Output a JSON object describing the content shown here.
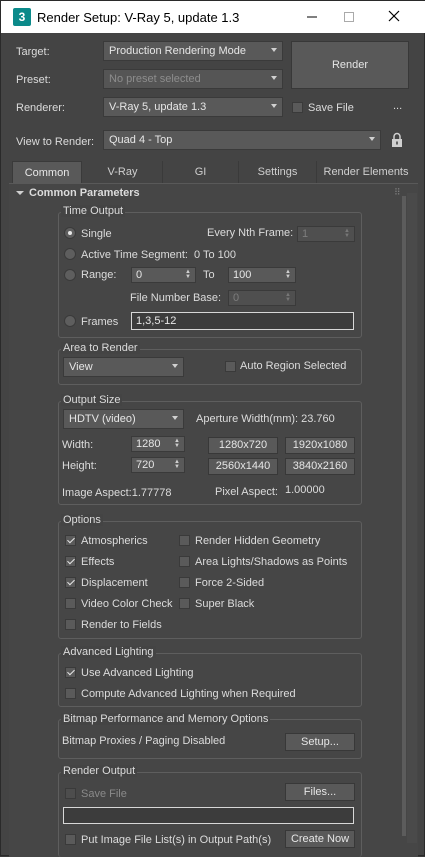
{
  "window": {
    "title": "Render Setup: V-Ray 5, update 1.3",
    "app_icon": "3"
  },
  "top": {
    "target_label": "Target:",
    "target_value": "Production Rendering Mode",
    "preset_label": "Preset:",
    "preset_value": "No preset selected",
    "renderer_label": "Renderer:",
    "renderer_value": "V-Ray 5, update 1.3",
    "render_button": "Render",
    "save_file_label": "Save File",
    "ellipsis": "...",
    "view_label": "View to Render:",
    "view_value": "Quad 4 - Top"
  },
  "tabs": [
    "Common",
    "V-Ray",
    "GI",
    "Settings",
    "Render Elements"
  ],
  "rollout": {
    "title": "Common Parameters"
  },
  "time_output": {
    "title": "Time Output",
    "single": "Single",
    "every_nth": "Every Nth Frame:",
    "every_nth_value": "1",
    "active_segment": "Active Time Segment:",
    "active_segment_value": "0 To 100",
    "range": "Range:",
    "range_from": "0",
    "range_to_label": "To",
    "range_to": "100",
    "file_number_base": "File Number Base:",
    "file_number_base_value": "0",
    "frames": "Frames",
    "frames_value": "1,3,5-12"
  },
  "area": {
    "title": "Area to Render",
    "value": "View",
    "auto_region": "Auto Region Selected"
  },
  "output_size": {
    "title": "Output Size",
    "preset": "HDTV (video)",
    "aperture": "Aperture Width(mm): 23.760",
    "width_label": "Width:",
    "width_value": "1280",
    "height_label": "Height:",
    "height_value": "720",
    "presets": [
      "1280x720",
      "1920x1080",
      "2560x1440",
      "3840x2160"
    ],
    "image_aspect": "Image Aspect:1.77778",
    "pixel_aspect_label": "Pixel Aspect:",
    "pixel_aspect_value": "1.00000"
  },
  "options": {
    "title": "Options",
    "left": [
      {
        "label": "Atmospherics",
        "checked": true
      },
      {
        "label": "Effects",
        "checked": true
      },
      {
        "label": "Displacement",
        "checked": true
      },
      {
        "label": "Video Color Check",
        "checked": false
      },
      {
        "label": "Render to Fields",
        "checked": false
      }
    ],
    "right": [
      {
        "label": "Render Hidden Geometry",
        "checked": false
      },
      {
        "label": "Area Lights/Shadows as Points",
        "checked": false
      },
      {
        "label": "Force 2-Sided",
        "checked": false
      },
      {
        "label": "Super Black",
        "checked": false
      }
    ]
  },
  "advanced_lighting": {
    "title": "Advanced Lighting",
    "use": "Use Advanced Lighting",
    "compute": "Compute Advanced Lighting when Required"
  },
  "bitmap": {
    "title": "Bitmap Performance and Memory Options",
    "status": "Bitmap Proxies / Paging Disabled",
    "setup": "Setup..."
  },
  "render_output": {
    "title": "Render Output",
    "save_file": "Save File",
    "files": "Files...",
    "path": "",
    "put_image": "Put Image File List(s) in Output Path(s)",
    "create_now": "Create Now"
  }
}
